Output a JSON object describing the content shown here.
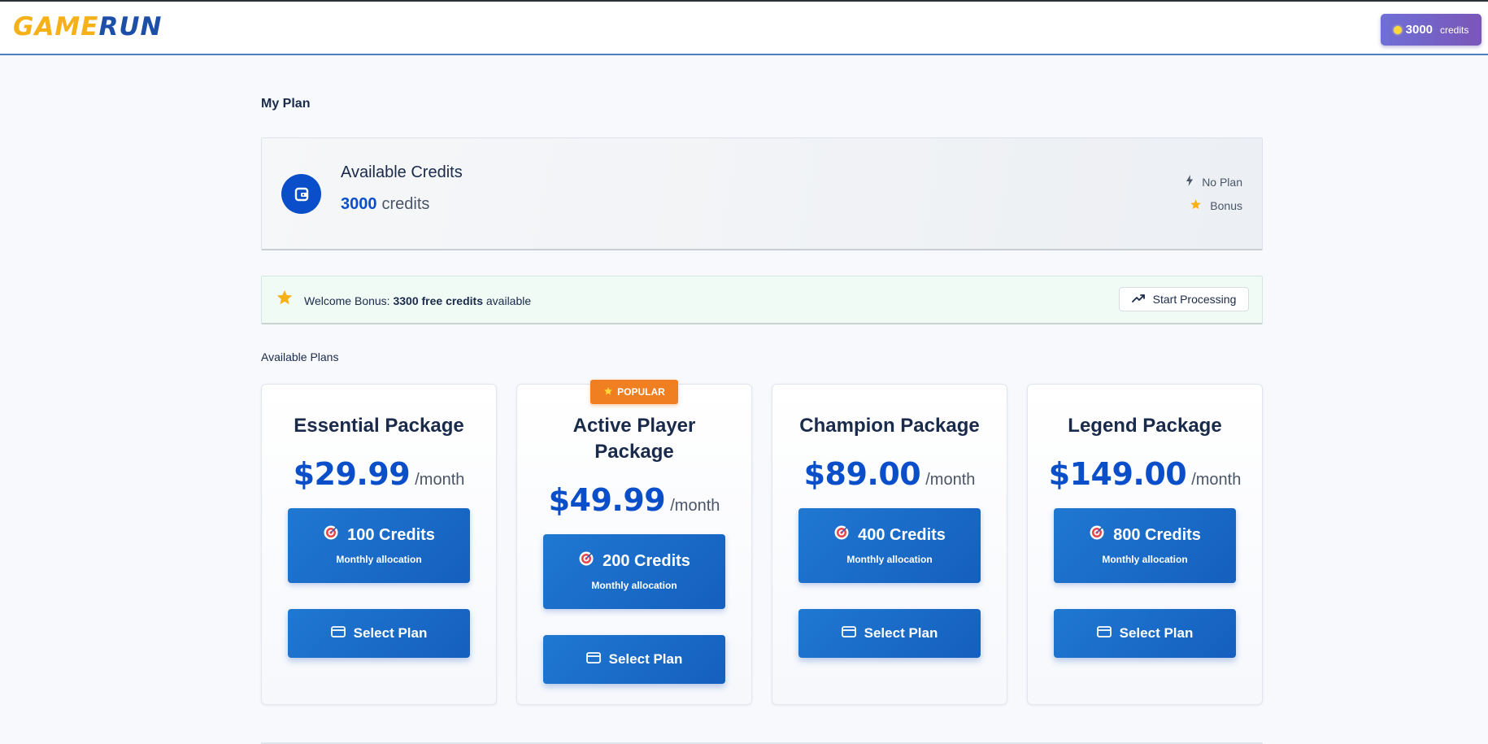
{
  "header": {
    "logo_part1": "GAME",
    "logo_part2": "RUN",
    "credits_value": "3000",
    "credits_label": "credits"
  },
  "page": {
    "title": "My Plan"
  },
  "balance": {
    "title": "Available Credits",
    "value": "3000",
    "unit": "credits",
    "plan_status": "No Plan",
    "bonus_label": "Bonus"
  },
  "bonus_banner": {
    "prefix": "Welcome Bonus: ",
    "highlight": "3300 free credits",
    "suffix": " available",
    "button_label": "Start Processing"
  },
  "plans_section": {
    "label": "Available Plans",
    "plans": [
      {
        "name": "Essential Package",
        "price": "$29.99",
        "period": "/month",
        "credits": "100 Credits",
        "credits_sub": "Monthly allocation",
        "button": "Select Plan"
      },
      {
        "name": "Active Player Package",
        "price": "$49.99",
        "period": "/month",
        "credits": "200 Credits",
        "credits_sub": "Monthly allocation",
        "button": "Select Plan",
        "badge": "POPULAR"
      },
      {
        "name": "Champion Package",
        "price": "$89.00",
        "period": "/month",
        "credits": "400 Credits",
        "credits_sub": "Monthly allocation",
        "button": "Select Plan"
      },
      {
        "name": "Legend Package",
        "price": "$149.00",
        "period": "/month",
        "credits": "800 Credits",
        "credits_sub": "Monthly allocation",
        "button": "Select Plan"
      }
    ]
  },
  "colors": {
    "brand_blue": "#0a4fc9",
    "logo_yellow": "#f6b119",
    "popular_orange": "#f07f22",
    "pill_purple": "#7060cc"
  },
  "icons": {
    "wallet": "wallet-icon",
    "bolt": "lightning-icon",
    "star": "star-icon",
    "trend": "trending-up-icon",
    "target": "target-icon",
    "card": "credit-card-icon"
  }
}
